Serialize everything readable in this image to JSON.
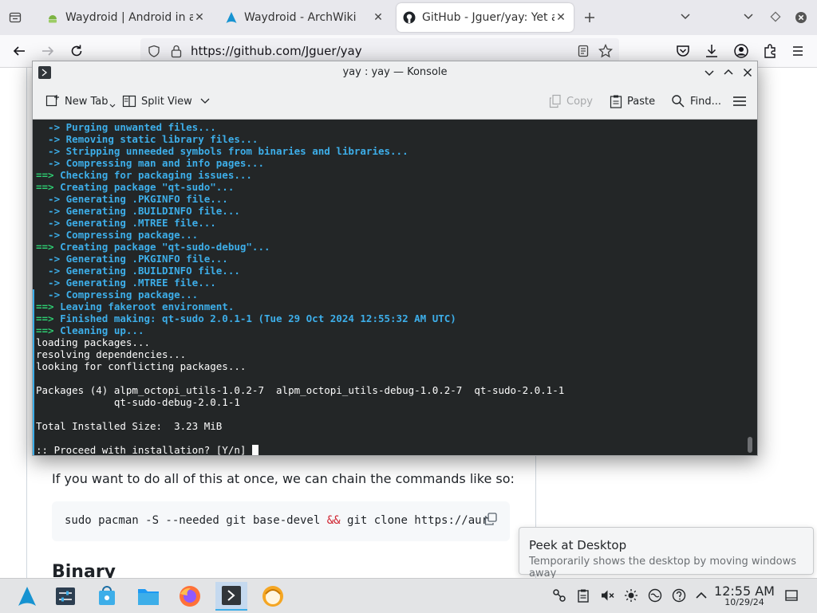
{
  "browser": {
    "tabs": [
      {
        "title": "Waydroid | Android in a Linux container",
        "active": false,
        "favicon": "waydroid-icon"
      },
      {
        "title": "Waydroid - ArchWiki",
        "active": false,
        "favicon": "arch-icon"
      },
      {
        "title": "GitHub - Jguer/yay: Yet another Yogurt",
        "active": true,
        "favicon": "github-icon"
      }
    ],
    "url": "https://github.com/Jguer/yay"
  },
  "page": {
    "paragraph": "If you want to do all of this at once, we can chain the commands like so:",
    "code_before": "sudo pacman -S --needed git base-devel ",
    "code_amp": "&&",
    "code_after": " git clone https://aur",
    "heading": "Binary"
  },
  "konsole": {
    "title": "yay : yay — Konsole",
    "toolbar": {
      "new_tab": "New Tab",
      "split_view": "Split View",
      "copy": "Copy",
      "paste": "Paste",
      "find": "Find..."
    },
    "lines": [
      {
        "prefix": "  -> ",
        "text": "Purging unwanted files...",
        "kind": "arrow"
      },
      {
        "prefix": "  -> ",
        "text": "Removing static library files...",
        "kind": "arrow"
      },
      {
        "prefix": "  -> ",
        "text": "Stripping unneeded symbols from binaries and libraries...",
        "kind": "arrow"
      },
      {
        "prefix": "  -> ",
        "text": "Compressing man and info pages...",
        "kind": "arrow"
      },
      {
        "prefix": "==> ",
        "text": "Checking for packaging issues...",
        "kind": "main"
      },
      {
        "prefix": "==> ",
        "text": "Creating package \"qt-sudo\"...",
        "kind": "main"
      },
      {
        "prefix": "  -> ",
        "text": "Generating .PKGINFO file...",
        "kind": "arrow"
      },
      {
        "prefix": "  -> ",
        "text": "Generating .BUILDINFO file...",
        "kind": "arrow"
      },
      {
        "prefix": "  -> ",
        "text": "Generating .MTREE file...",
        "kind": "arrow"
      },
      {
        "prefix": "  -> ",
        "text": "Compressing package...",
        "kind": "arrow"
      },
      {
        "prefix": "==> ",
        "text": "Creating package \"qt-sudo-debug\"...",
        "kind": "main"
      },
      {
        "prefix": "  -> ",
        "text": "Generating .PKGINFO file...",
        "kind": "arrow"
      },
      {
        "prefix": "  -> ",
        "text": "Generating .BUILDINFO file...",
        "kind": "arrow"
      },
      {
        "prefix": "  -> ",
        "text": "Generating .MTREE file...",
        "kind": "arrow"
      },
      {
        "prefix": "  -> ",
        "text": "Compressing package...",
        "kind": "arrow"
      },
      {
        "prefix": "==> ",
        "text": "Leaving fakeroot environment.",
        "kind": "main"
      },
      {
        "prefix": "==> ",
        "text": "Finished making: qt-sudo 2.0.1-1 (Tue 29 Oct 2024 12:55:32 AM UTC)",
        "kind": "main"
      },
      {
        "prefix": "==> ",
        "text": "Cleaning up...",
        "kind": "main"
      },
      {
        "prefix": "",
        "text": "loading packages...",
        "kind": "plain"
      },
      {
        "prefix": "",
        "text": "resolving dependencies...",
        "kind": "plain"
      },
      {
        "prefix": "",
        "text": "looking for conflicting packages...",
        "kind": "plain"
      },
      {
        "prefix": "",
        "text": "",
        "kind": "plain"
      },
      {
        "prefix": "",
        "text": "Packages (4) alpm_octopi_utils-1.0.2-7  alpm_octopi_utils-debug-1.0.2-7  qt-sudo-2.0.1-1",
        "kind": "plain"
      },
      {
        "prefix": "",
        "text": "             qt-sudo-debug-2.0.1-1",
        "kind": "plain"
      },
      {
        "prefix": "",
        "text": "",
        "kind": "plain"
      },
      {
        "prefix": "",
        "text": "Total Installed Size:  3.23 MiB",
        "kind": "plain"
      },
      {
        "prefix": "",
        "text": "",
        "kind": "plain"
      },
      {
        "prefix": "",
        "text": ":: Proceed with installation? [Y/n] ",
        "kind": "prompt"
      }
    ]
  },
  "tooltip": {
    "title": "Peek at Desktop",
    "subtitle": "Temporarily shows the desktop by moving windows away"
  },
  "taskbar": {
    "time": "12:55 AM",
    "date": "10/29/24",
    "apps": [
      "app-launcher-icon",
      "system-settings-icon",
      "discover-icon",
      "files-icon",
      "firefox-icon",
      "konsole-icon",
      "octopi-icon"
    ]
  },
  "colors": {
    "terminal_bg": "#232627",
    "terminal_blue": "#3daee9",
    "terminal_green": "#2ecc71",
    "accent": "#3daee9"
  }
}
